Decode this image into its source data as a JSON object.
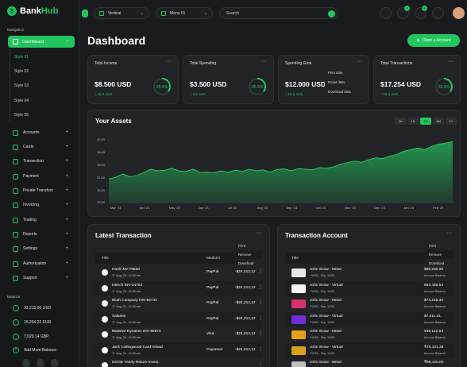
{
  "brand": {
    "part1": "Bank",
    "part2": "Hub",
    "logo": "$"
  },
  "colors": {
    "accent": "#22c55e",
    "bg": "#1a1b1e",
    "card": "#222326"
  },
  "sidebar": {
    "navigation_label": "Navigation",
    "dashboard": "Dashboard",
    "styles": [
      "Style 01",
      "Style 02",
      "Style 03",
      "Style 04",
      "Style 05"
    ],
    "items": [
      "Accounts",
      "Cards",
      "Transection",
      "Payment",
      "Private Transfers",
      "Invoicing",
      "Trading",
      "Reports",
      "Settings",
      "Authorization",
      "Support"
    ],
    "balance_label": "Balance",
    "balances": [
      "33,215.00 USD",
      "15,254.32 EUR",
      "7,029.14 GBP"
    ],
    "add_balance": "Add More Balance"
  },
  "topbar": {
    "layout_select": "Vertical",
    "menu_select": "Menu 01",
    "search_placeholder": "Search",
    "notif_count": "2",
    "msg_count": "5"
  },
  "page_title": "Dashboard",
  "open_account": "Open a Account",
  "stats": [
    {
      "title": "Total Income",
      "value": "$8.500 USD",
      "change": "↑ 16.2 AVG",
      "pct": "35.5%",
      "progress": 0.355
    },
    {
      "title": "Total Spending",
      "value": "$3.500 USD",
      "change": "↑ 3.2 AVG",
      "pct": "35.5%",
      "progress": 0.355
    },
    {
      "title": "Spending Goal",
      "value": "$12.000 USD",
      "change": "↑ 16.2 AVG",
      "pct": "35.5%",
      "progress": 0.355
    },
    {
      "title": "Total Transactions",
      "value": "$17.254 USD",
      "change": "↑ 16.2 AVG",
      "pct": "35.5%",
      "progress": 0.355
    }
  ],
  "stat_menu": [
    "Print data",
    "Reset data",
    "Download data"
  ],
  "assets": {
    "title": "Your Assets",
    "ranges": [
      "1H",
      "1D",
      "1W",
      "1M",
      "1Y"
    ],
    "active": "1W"
  },
  "chart_data": {
    "type": "area",
    "title": "Your Assets",
    "x_labels": [
      "Mar '23",
      "Apr '23",
      "May '23",
      "Jun '23",
      "Jul '23",
      "Aug '23",
      "Sep '23",
      "Oct '23",
      "Nov '23",
      "Dec '23",
      "Jan '24",
      "Feb '24"
    ],
    "y_ticks": [
      "42.00",
      "38.00",
      "35.00",
      "31.00",
      "28.00",
      "23.00",
      "21.00"
    ],
    "ylim": [
      21,
      42
    ],
    "values": [
      28.5,
      29,
      30,
      29.2,
      29.5,
      30.5,
      31.5,
      31,
      31.2,
      31.8,
      31,
      30.8,
      31.5,
      30.5,
      30.6,
      30.4,
      31,
      30.5,
      31.2,
      30.8,
      31.5,
      31,
      31.3,
      30.6,
      31.4,
      31.6,
      31,
      31.7,
      31.5,
      31.3,
      32,
      31.8,
      32.2,
      33,
      33.5,
      34,
      33.6,
      34.4,
      35,
      34.8,
      35.5,
      36,
      37,
      37.5,
      38,
      37.5,
      38.5,
      39.2,
      39.5,
      40
    ]
  },
  "latest": {
    "title": "Latest Transaction",
    "headers": [
      "Title",
      "Medium"
    ],
    "menu": [
      "Print",
      "Remove",
      "Download"
    ],
    "rows": [
      {
        "name": "Hooli INV-79820",
        "date": "17 Aug, 24, 10:36 am",
        "medium": "PayPal",
        "amount": "-$24,212,12"
      },
      {
        "name": "Initech INV-24792",
        "date": "17 Aug, 24, 10:36 am",
        "medium": "PayPal",
        "amount": "-$24,212,12"
      },
      {
        "name": "Bluth Company INV-84732",
        "date": "17 Aug, 24, 10:36 am",
        "medium": "PayPal",
        "amount": "-$24,212,12"
      },
      {
        "name": "Salaries",
        "date": "17 Aug, 24, 10:36 am",
        "medium": "PayPal",
        "amount": "-$24,212,12"
      },
      {
        "name": "Massive Dynamic INV-90874",
        "date": "17 Aug, 24, 10:36 am",
        "medium": "Visa",
        "amount": "-$24,212,12"
      },
      {
        "name": "Jack Collingwood Card reload",
        "date": "17 Aug, 24, 10:36 am",
        "medium": "Payoneer",
        "amount": "-$24,212,12"
      },
      {
        "name": "DOGE Yearly Return Invest.",
        "date": "",
        "medium": "",
        "amount": ""
      }
    ]
  },
  "accounts": {
    "title": "Transaction Account",
    "headers": [
      "Title"
    ],
    "menu": [
      "Print",
      "Remove",
      "Download"
    ],
    "rows": [
      {
        "name": "John Snow - Metal",
        "sub": "**4291 - Exp: 12/26",
        "amount": "$85,200.00",
        "bal": "Account Balance",
        "color": "#e8e8e8"
      },
      {
        "name": "John Snow - Virtual",
        "sub": "**4291 - Exp: 12/26",
        "amount": "€54,448.54",
        "bal": "Account Balance",
        "color": "#f2f2f2"
      },
      {
        "name": "John Snow - Metal",
        "sub": "**4291 - Exp: 12/26",
        "amount": "$74,215.32",
        "bal": "Account Balance",
        "color": "#d6336c"
      },
      {
        "name": "John Snow - Virtual",
        "sub": "**4291 - Exp: 12/26",
        "amount": "$7,511.21",
        "bal": "Account Balance",
        "color": "#6b2fd6"
      },
      {
        "name": "John Snow - Metal",
        "sub": "**4291 - Exp: 12/26",
        "amount": "¥36,122.54",
        "bal": "Account Balance",
        "color": "#e4a11b"
      },
      {
        "name": "John Snow - Virtual",
        "sub": "**4291 - Exp: 12/26",
        "amount": "₹75,121.36",
        "bal": "Account Balance",
        "color": "#d9a21b"
      },
      {
        "name": "John Snow - Metal",
        "sub": "",
        "amount": "₹68,125.00",
        "bal": "",
        "color": "#c0c0c0"
      }
    ]
  }
}
